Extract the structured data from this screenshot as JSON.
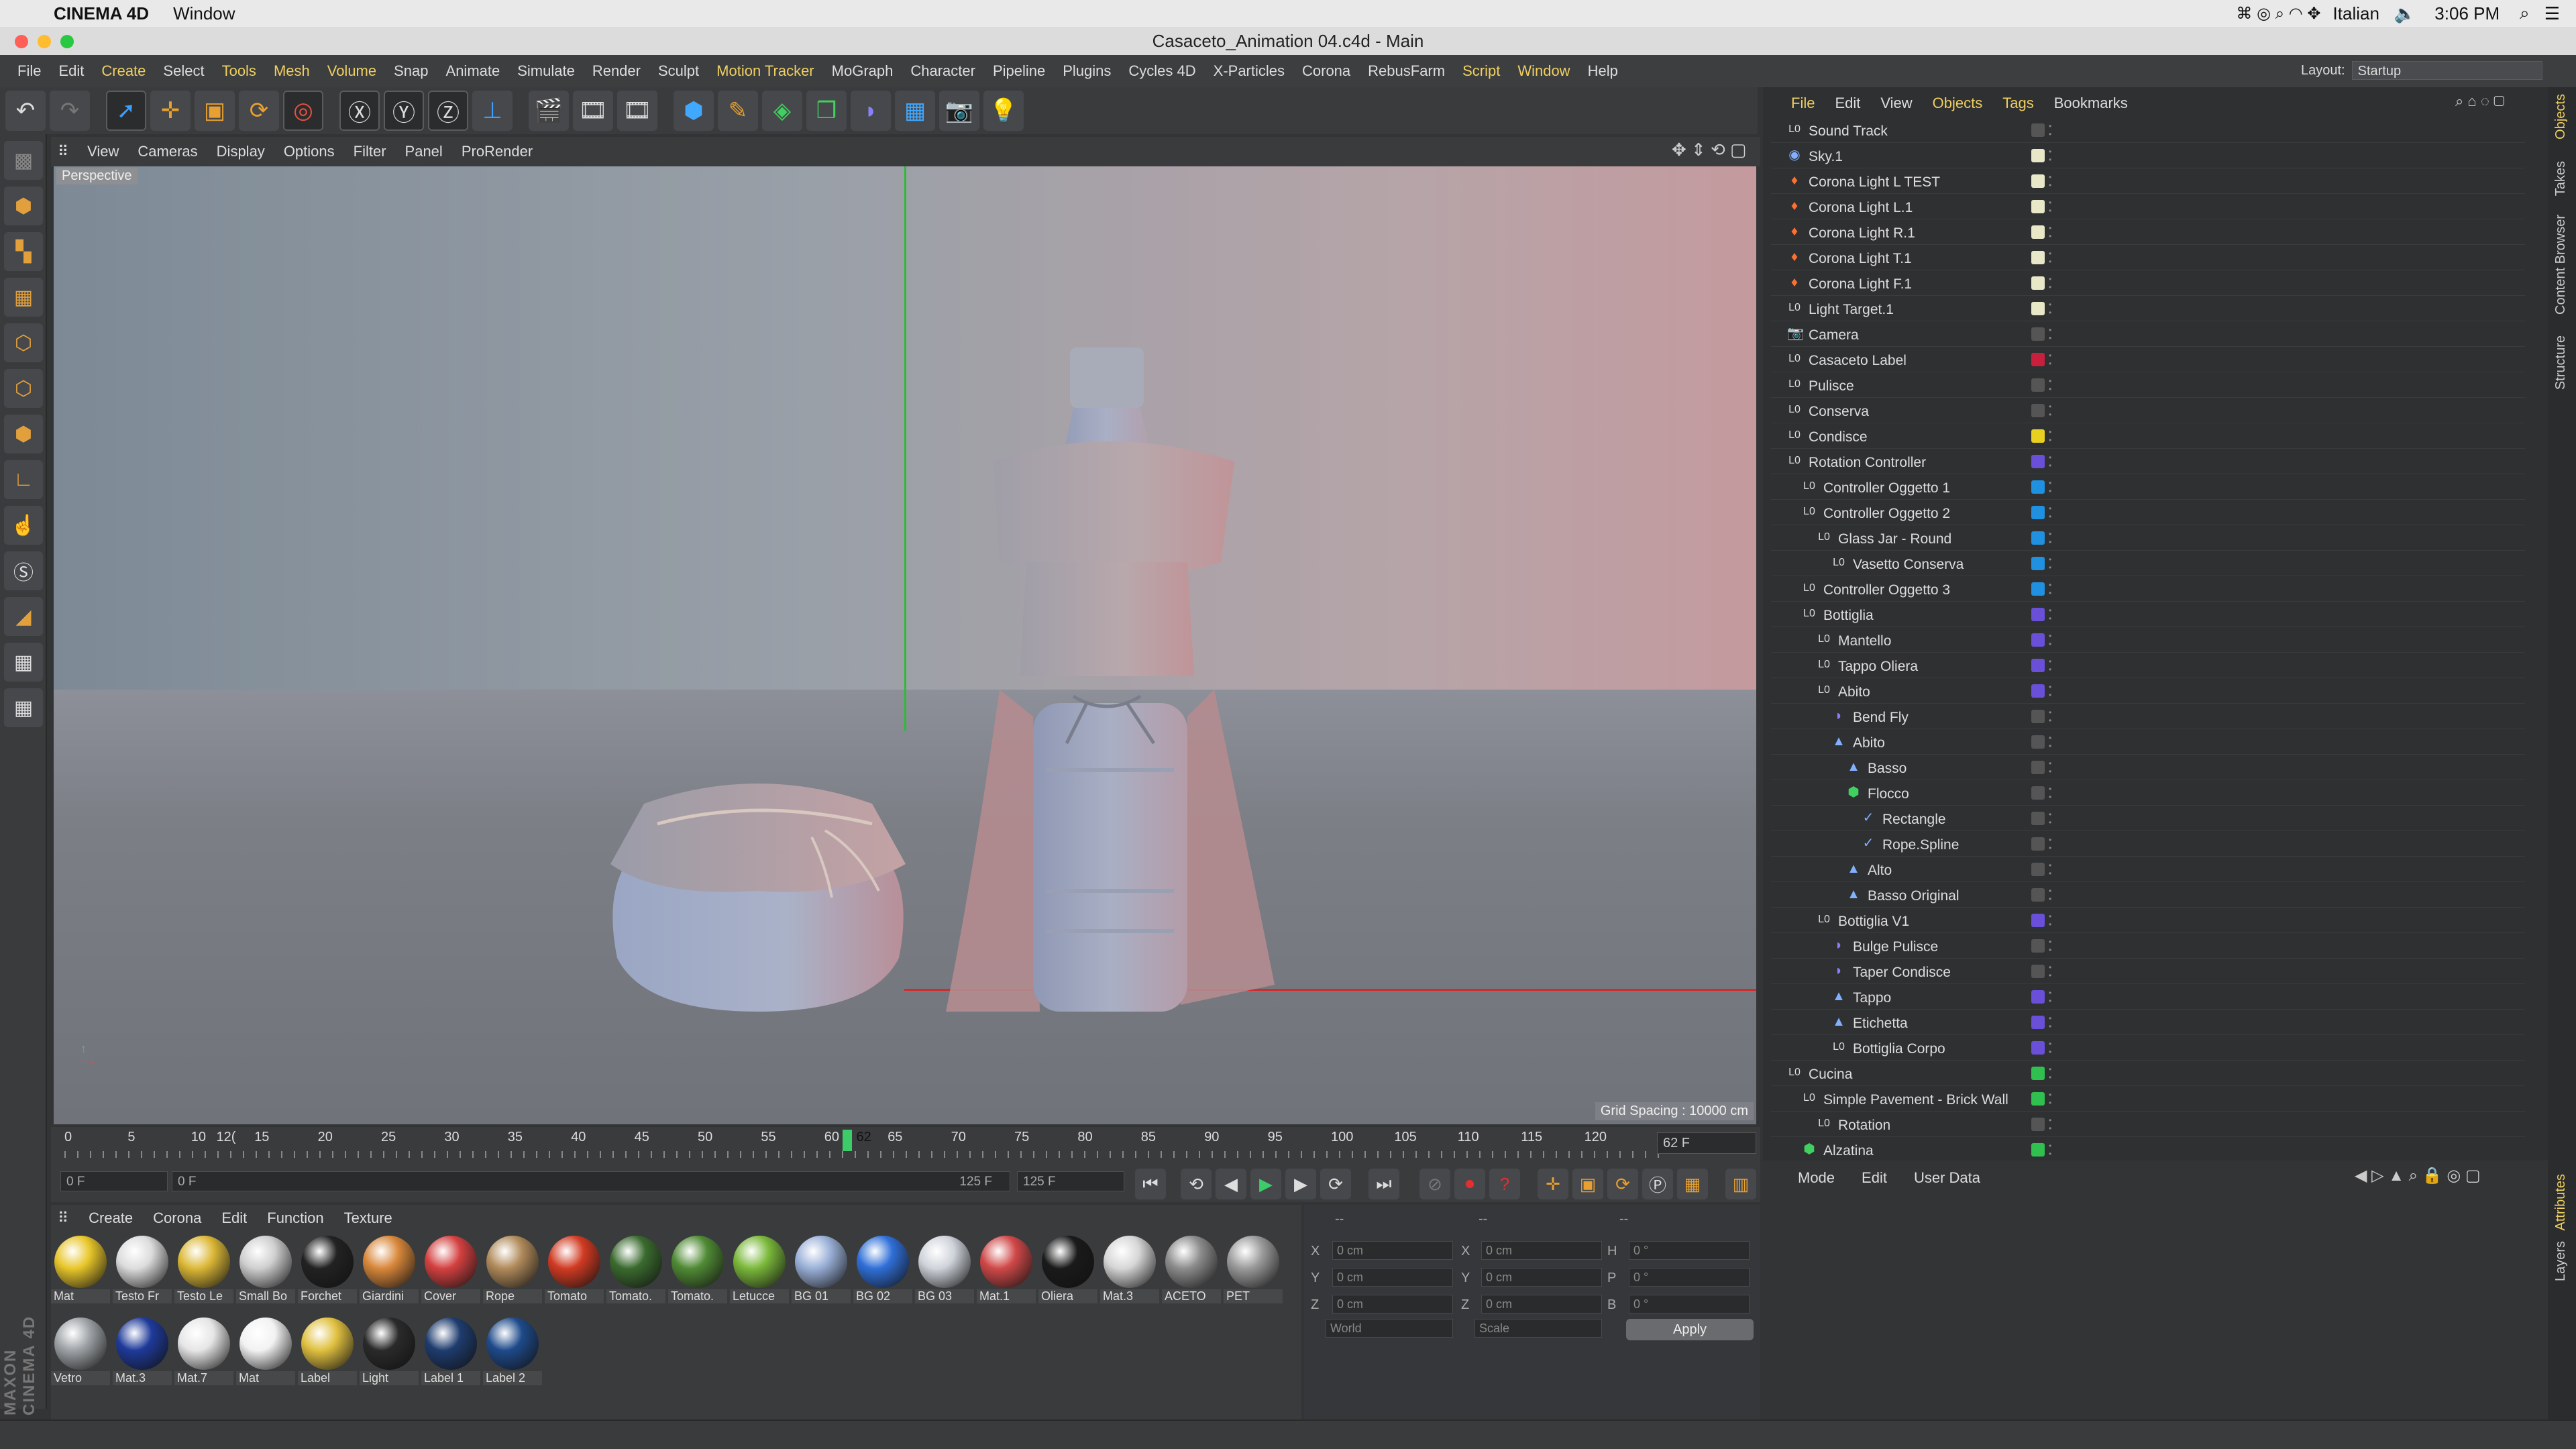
{
  "mac_menu": {
    "app": "CINEMA 4D",
    "window": "Window",
    "language": "Italian",
    "time": "3:06 PM"
  },
  "window": {
    "title": "Casaceto_Animation 04.c4d - Main"
  },
  "menubar": [
    "File",
    "Edit",
    "Create",
    "Select",
    "Tools",
    "Mesh",
    "Volume",
    "Snap",
    "Animate",
    "Simulate",
    "Render",
    "Sculpt",
    "Motion Tracker",
    "MoGraph",
    "Character",
    "Pipeline",
    "Plugins",
    "Cycles 4D",
    "X-Particles",
    "Corona",
    "RebusFarm",
    "Script",
    "Window",
    "Help"
  ],
  "layout": {
    "label": "Layout:",
    "value": "Startup"
  },
  "viewport": {
    "menu": [
      "View",
      "Cameras",
      "Display",
      "Options",
      "Filter",
      "Panel",
      "ProRender"
    ],
    "label": "Perspective",
    "grid_spacing": "Grid Spacing : 10000 cm"
  },
  "timeline": {
    "ticks": [
      "0",
      "5",
      "10",
      "15",
      "20",
      "25",
      "30",
      "35",
      "40",
      "45",
      "50",
      "55",
      "60",
      "62",
      "65",
      "70",
      "75",
      "80",
      "85",
      "90",
      "95",
      "100",
      "105",
      "110",
      "115",
      "120",
      "12("
    ],
    "current_frame": "62 F",
    "start": "0 F",
    "range_start": "0 F",
    "range_end": "125 F",
    "end": "125 F"
  },
  "materials": {
    "menu": [
      "Create",
      "Corona",
      "Edit",
      "Function",
      "Texture"
    ],
    "items": [
      {
        "label": "Mat",
        "color": "#e8c62a"
      },
      {
        "label": "Testo Fr",
        "color": "#dcdcdc"
      },
      {
        "label": "Testo Le",
        "color": "#dcb836"
      },
      {
        "label": "Small Bo",
        "color": "#cfcfcf"
      },
      {
        "label": "Forchet",
        "color": "#222222"
      },
      {
        "label": "Giardini",
        "color": "#d8873a"
      },
      {
        "label": "Cover",
        "color": "#d44040"
      },
      {
        "label": "Rope",
        "color": "#b08a5a"
      },
      {
        "label": "Tomato",
        "color": "#d13a22"
      },
      {
        "label": "Tomato.",
        "color": "#3a6a2e"
      },
      {
        "label": "Tomato.",
        "color": "#4f8a34"
      },
      {
        "label": "Letucce",
        "color": "#7ab83a"
      },
      {
        "label": "BG 01",
        "color": "#9ab0d8"
      },
      {
        "label": "BG 02",
        "color": "#2f6fd8"
      },
      {
        "label": "BG 03",
        "color": "#cfd3da"
      },
      {
        "label": "Mat.1",
        "color": "#d04848"
      },
      {
        "label": "Oliera",
        "color": "#1a1a1a"
      },
      {
        "label": "Mat.3",
        "color": "#d6d6d6"
      },
      {
        "label": "ACETO",
        "color": "#8c8c8c"
      },
      {
        "label": "PET",
        "color": "#9a9a9a"
      },
      {
        "label": "Vetro",
        "color": "#9ea2a6"
      },
      {
        "label": "Mat.3",
        "color": "#1e3a9a"
      },
      {
        "label": "Mat.7",
        "color": "#e6e6e6"
      },
      {
        "label": "Mat",
        "color": "#f2f2f2"
      },
      {
        "label": "Label",
        "color": "#e0c040"
      },
      {
        "label": "Light",
        "color": "#2a2a2a"
      },
      {
        "label": "Label 1",
        "color": "#1e3c6e"
      },
      {
        "label": "Label 2",
        "color": "#1e4a8a"
      }
    ]
  },
  "coordinates": {
    "headers": [
      "--",
      "--",
      "--"
    ],
    "rows": [
      {
        "a": "X",
        "av": "0 cm",
        "b": "X",
        "bv": "0 cm",
        "c": "H",
        "cv": "0 °"
      },
      {
        "a": "Y",
        "av": "0 cm",
        "b": "Y",
        "bv": "0 cm",
        "c": "P",
        "cv": "0 °"
      },
      {
        "a": "Z",
        "av": "0 cm",
        "b": "Z",
        "bv": "0 cm",
        "c": "B",
        "cv": "0 °"
      }
    ],
    "mode1": "World",
    "mode2": "Scale",
    "apply": "Apply"
  },
  "objects": {
    "menu": [
      "File",
      "Edit",
      "View",
      "Objects",
      "Tags",
      "Bookmarks"
    ],
    "rows": [
      {
        "name": "Sound Track",
        "depth": 0,
        "icon": "null-icon",
        "color": "#555555"
      },
      {
        "name": "Sky.1",
        "depth": 0,
        "icon": "sky-icon",
        "color": "#e8e8c8"
      },
      {
        "name": "Corona Light L TEST",
        "depth": 0,
        "icon": "light-icon",
        "color": "#e8e8c8"
      },
      {
        "name": "Corona Light L.1",
        "depth": 0,
        "icon": "light-icon",
        "color": "#e8e8c8"
      },
      {
        "name": "Corona Light R.1",
        "depth": 0,
        "icon": "light-icon",
        "color": "#e8e8c8"
      },
      {
        "name": "Corona Light T.1",
        "depth": 0,
        "icon": "light-icon",
        "color": "#e8e8c8"
      },
      {
        "name": "Corona Light F.1",
        "depth": 0,
        "icon": "light-icon",
        "color": "#e8e8c8"
      },
      {
        "name": "Light Target.1",
        "depth": 0,
        "icon": "null-icon",
        "color": "#e8e8c8"
      },
      {
        "name": "Camera",
        "depth": 0,
        "icon": "camera-icon",
        "color": "#555555"
      },
      {
        "name": "Casaceto Label",
        "depth": 0,
        "icon": "null-icon",
        "color": "#c8203c"
      },
      {
        "name": "Pulisce",
        "depth": 0,
        "icon": "null-icon",
        "color": "#555555"
      },
      {
        "name": "Conserva",
        "depth": 0,
        "icon": "null-icon",
        "color": "#555555"
      },
      {
        "name": "Condisce",
        "depth": 0,
        "icon": "null-icon",
        "color": "#e8d020"
      },
      {
        "name": "Rotation Controller",
        "depth": 0,
        "icon": "null-icon",
        "color": "#6a50d8"
      },
      {
        "name": "Controller Oggetto 1",
        "depth": 1,
        "icon": "null-icon",
        "color": "#2090e0"
      },
      {
        "name": "Controller Oggetto 2",
        "depth": 1,
        "icon": "null-icon",
        "color": "#2090e0"
      },
      {
        "name": "Glass Jar - Round",
        "depth": 2,
        "icon": "null-icon",
        "color": "#2090e0"
      },
      {
        "name": "Vasetto Conserva",
        "depth": 3,
        "icon": "null-icon",
        "color": "#2090e0"
      },
      {
        "name": "Controller Oggetto 3",
        "depth": 1,
        "icon": "null-icon",
        "color": "#2090e0"
      },
      {
        "name": "Bottiglia",
        "depth": 1,
        "icon": "null-icon",
        "color": "#6a50d8"
      },
      {
        "name": "Mantello",
        "depth": 2,
        "icon": "null-icon",
        "color": "#6a50d8"
      },
      {
        "name": "Tappo Oliera",
        "depth": 2,
        "icon": "null-icon",
        "color": "#6a50d8"
      },
      {
        "name": "Abito",
        "depth": 2,
        "icon": "null-icon",
        "color": "#6a50d8"
      },
      {
        "name": "Bend Fly",
        "depth": 3,
        "icon": "deformer-icon",
        "color": "#555555"
      },
      {
        "name": "Abito",
        "depth": 3,
        "icon": "polygon-icon",
        "color": "#555555"
      },
      {
        "name": "Basso",
        "depth": 4,
        "icon": "polygon-icon",
        "color": "#555555"
      },
      {
        "name": "Flocco",
        "depth": 4,
        "icon": "sweep-icon",
        "color": "#555555"
      },
      {
        "name": "Rectangle",
        "depth": 5,
        "icon": "spline-icon",
        "color": "#555555"
      },
      {
        "name": "Rope.Spline",
        "depth": 5,
        "icon": "spline-icon",
        "color": "#555555"
      },
      {
        "name": "Alto",
        "depth": 4,
        "icon": "polygon-icon",
        "color": "#555555"
      },
      {
        "name": "Basso Original",
        "depth": 4,
        "icon": "polygon-icon",
        "color": "#555555"
      },
      {
        "name": "Bottiglia V1",
        "depth": 2,
        "icon": "null-icon",
        "color": "#6a50d8"
      },
      {
        "name": "Bulge Pulisce",
        "depth": 3,
        "icon": "deformer-icon",
        "color": "#555555"
      },
      {
        "name": "Taper Condisce",
        "depth": 3,
        "icon": "deformer-icon",
        "color": "#555555"
      },
      {
        "name": "Tappo",
        "depth": 3,
        "icon": "polygon-icon",
        "color": "#6a50d8"
      },
      {
        "name": "Etichetta",
        "depth": 3,
        "icon": "polygon-icon",
        "color": "#6a50d8"
      },
      {
        "name": "Bottiglia Corpo",
        "depth": 3,
        "icon": "null-icon",
        "color": "#6a50d8"
      },
      {
        "name": "Cucina",
        "depth": 0,
        "icon": "null-icon",
        "color": "#30c050"
      },
      {
        "name": "Simple Pavement - Brick Wall",
        "depth": 1,
        "icon": "null-icon",
        "color": "#30c050"
      },
      {
        "name": "Rotation",
        "depth": 2,
        "icon": "null-icon",
        "color": "#555555"
      },
      {
        "name": "Alzatina",
        "depth": 1,
        "icon": "cube-icon",
        "color": "#30c050"
      }
    ]
  },
  "attributes": {
    "menu": [
      "Mode",
      "Edit",
      "User Data"
    ]
  },
  "side_tabs": [
    "Objects",
    "Takes",
    "Content Browser",
    "Structure",
    "Attributes",
    "Layers"
  ],
  "brand": "MAXON CINEMA 4D"
}
